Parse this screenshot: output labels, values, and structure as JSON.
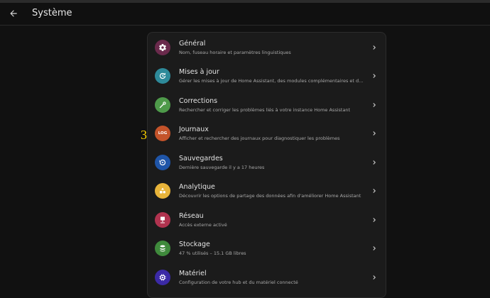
{
  "header": {
    "title": "Système",
    "back_icon": "arrow-left-icon"
  },
  "annotation": "3",
  "items": [
    {
      "label": "Général",
      "description": "Nom, fuseau horaire et paramètres linguistiques",
      "icon": "gear-icon",
      "color": "#6a2a4c"
    },
    {
      "label": "Mises à jour",
      "description": "Gérer les mises à jour de Home Assistant, des modules complémentaires et d…",
      "icon": "update-icon",
      "color": "#2e8a9a"
    },
    {
      "label": "Corrections",
      "description": "Rechercher et corriger les problèmes liés à votre instance Home Assistant",
      "icon": "wrench-icon",
      "color": "#4e9a4a"
    },
    {
      "label": "Journaux",
      "description": "Afficher et rechercher des journaux pour diagnostiquer les problèmes",
      "icon": "log-icon",
      "icon_text": "LOG",
      "color": "#c4532a"
    },
    {
      "label": "Sauvegardes",
      "description": "Dernière sauvegarde il y a 17 heures",
      "icon": "backup-icon",
      "color": "#1f55a8"
    },
    {
      "label": "Analytique",
      "description": "Découvrir les options de partage des données afin d'améliorer Home Assistant",
      "icon": "shapes-icon",
      "color": "#e8b43a"
    },
    {
      "label": "Réseau",
      "description": "Accès externe activé",
      "icon": "network-icon",
      "color": "#b0334f"
    },
    {
      "label": "Stockage",
      "description": "47 % utilisés – 15.1 GB libres",
      "icon": "database-icon",
      "color": "#3f8a3c"
    },
    {
      "label": "Matériel",
      "description": "Configuration de votre hub et du matériel connecté",
      "icon": "chip-icon",
      "color": "#3b2aa6"
    }
  ]
}
